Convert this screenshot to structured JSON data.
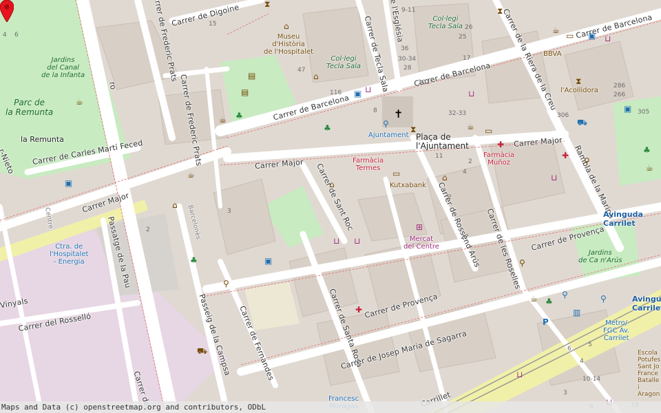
{
  "attribution": "Maps and Data (c) openstreetmap.org and contributors, ODbL",
  "streets": {
    "barcelona_a": "Carrer de Barcelona",
    "barcelona_b": "Carrer de Barcelona",
    "barcelona_c": "Carrer de Barcelona",
    "major_a": "Carrer Major",
    "major_b": "Carrer Major",
    "major_c": "Carrer Major",
    "digoine": "Carrer de Digoine",
    "frederic_a": "Carrer de Frederic Prats",
    "frederic_b": "Carrer de Frederic Prats",
    "carles": "Carrer de Carles Martí Feced",
    "sant_roc": "Carrer de Sant Roc",
    "rossend": "Carrer de Rossend Arús",
    "rosellers": "Carrer de les Roselles",
    "provenca_a": "Carrer de Provença",
    "provenca_b": "Carrer de Provença",
    "santa_rosa": "Carrer de Santa Rosa",
    "sagarra": "Carrer de Josep Maria de Sagarra",
    "fernandes": "Carrer de Fernandes",
    "campsa": "Passeig de la Campsa",
    "passatge_pau": "Passatge de la Pau",
    "rossello": "Carrer del Rosselló",
    "riera": "Carrer de la Riera de la Creu",
    "rambla": "Rambla de la Marina",
    "tecla": "Carrer de Tecla Sala",
    "esglesia": "de l'Església",
    "nieto": "r-Nieto",
    "vinyals": "Vinyals",
    "carrillet_s": "Carrillet",
    "delf": "Carrer del",
    "ro": "ro",
    "centre": "Centre",
    "barcelones": "Barcelonès"
  },
  "places": {
    "placa": "Plaça de\nl'Ajuntament",
    "avinguda1": "Avinguda\nCarrilet",
    "avinguda2": "Avinguda\nCarrilet",
    "la_remunta": "la Remunta"
  },
  "parks": {
    "remunta": "Parc de\nla Remunta",
    "jardins_canal": "Jardins\ndel Canal\nde la Infanta",
    "jardins_can": "Jardins\nde Ca n'Arús"
  },
  "pois": {
    "museu": "Museu\nd'Història\nde l'Hospitalet",
    "collegi1": "Col·legi\nTecla Sala",
    "collegi2": "Col·legi\nTecla Sala",
    "ajuntament": "Ajuntament",
    "farmacia_termes": "Farmàcia\nTermes",
    "farmacia_munoz": "Farmàcia\nMuñoz",
    "kutxabank": "Kutxabank",
    "mercat": "Mercat\ndel Centre",
    "bbva": "BBVA",
    "acollidora": "l'Acollidora",
    "ctra": "Ctra. de\nl'Hospitalet\n- Energia",
    "metro": "Metro/\nFGC Av.\nCarrilet",
    "francesc": "Francesc\nMoragas",
    "escola": "Escola\nPotufes\nSant Jo\nFrance\nBatalle\ni Aragon"
  },
  "house_numbers": [
    "15",
    "47",
    "116",
    "8",
    "102",
    "306",
    "305",
    "286",
    "266",
    "9-11",
    "26",
    "25",
    "36",
    "30-34",
    "28",
    "17",
    "32-33",
    "11",
    "2",
    "4",
    "3",
    "2",
    "27",
    "2",
    "6",
    "6",
    "5",
    "4",
    "10-14",
    "3",
    "19",
    "4",
    "6"
  ]
}
